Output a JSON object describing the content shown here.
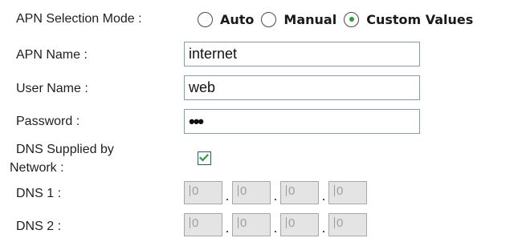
{
  "apn_selection": {
    "label": "APN Selection Mode :",
    "options": [
      {
        "label": "Auto",
        "selected": false
      },
      {
        "label": "Manual",
        "selected": false
      },
      {
        "label": "Custom Values",
        "selected": true
      }
    ]
  },
  "apn_name": {
    "label": "APN Name :",
    "value": "internet"
  },
  "user_name": {
    "label": "User Name :",
    "value": "web"
  },
  "password": {
    "label": "Password :",
    "value": "•••"
  },
  "dns_supplied": {
    "label_line1": "DNS Supplied by",
    "label_line2": "Network :",
    "checked": true
  },
  "dns1": {
    "label": "DNS 1 :",
    "octets": [
      "0",
      "0",
      "0",
      "0"
    ],
    "separator": "."
  },
  "dns2": {
    "label": "DNS 2 :",
    "octets": [
      "0",
      "0",
      "0",
      "0"
    ],
    "separator": "."
  },
  "colors": {
    "radio_dot": "#2e9e3e",
    "checkbox_border": "#1d5b8c",
    "input_border": "#7f9db9",
    "disabled_bg": "#e4e4e4"
  }
}
